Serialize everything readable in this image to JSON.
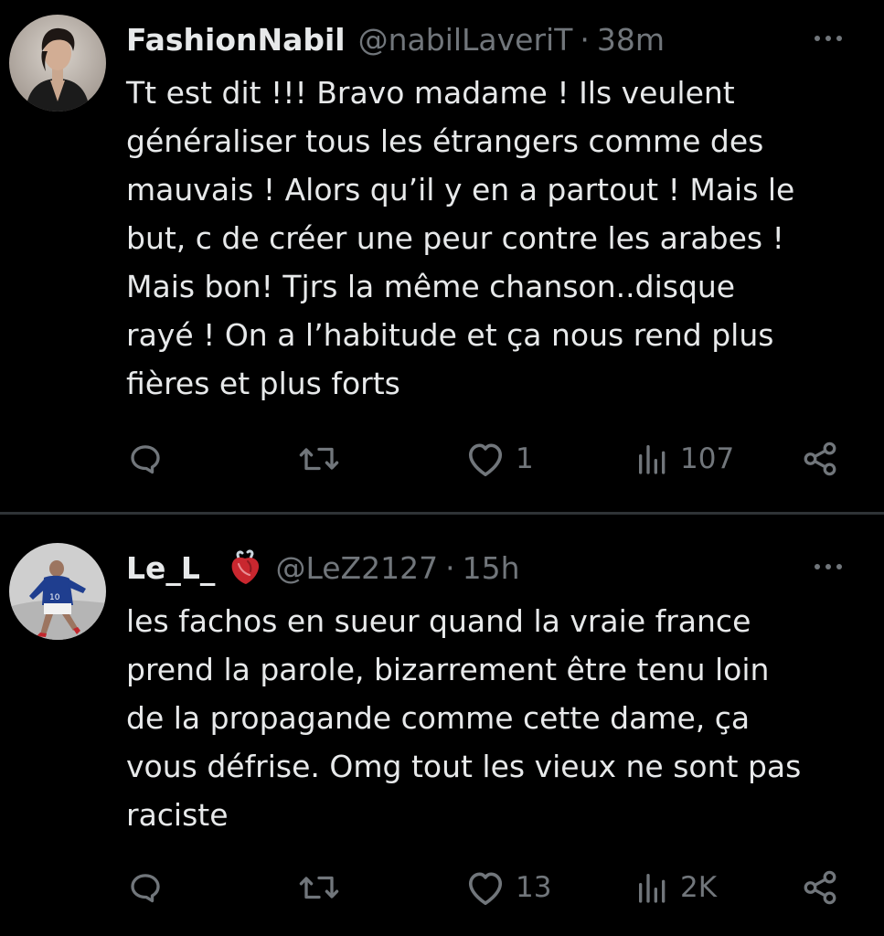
{
  "colors": {
    "background": "#000000",
    "text": "#e7e9ea",
    "muted": "#71767b",
    "divider": "#2f3336"
  },
  "tweets": [
    {
      "display_name": "FashionNabil",
      "handle": "@nabilLaveriT",
      "separator": "·",
      "time": "38m",
      "text": "Tt est dit !!! Bravo madame ! Ils veulent\ngénéraliser tous les étrangers comme des\nmauvais ! Alors qu’il y en a partout ! Mais le\nbut, c de créer une peur contre les arabes !\nMais bon! Tjrs la même chanson..disque\nrayé ! On a l’habitude et ça nous rend plus\nfières et plus forts",
      "likes": "1",
      "views": "107",
      "avatar_icon": "user-avatar-photo"
    },
    {
      "display_name": "Le_L_",
      "name_emoji": "anatomical-heart-icon",
      "handle": "@LeZ2127",
      "separator": "·",
      "time": "15h",
      "text": "les fachos en sueur quand la vraie france\nprend la parole, bizarrement être tenu loin\nde la propagande comme cette dame, ça\nvous défrise. Omg tout les vieux ne sont pas\nraciste",
      "likes": "13",
      "views": "2K",
      "avatar_icon": "footballer-avatar-photo"
    }
  ],
  "action_icons": [
    "reply-icon",
    "retweet-icon",
    "like-icon",
    "views-icon",
    "share-icon"
  ]
}
